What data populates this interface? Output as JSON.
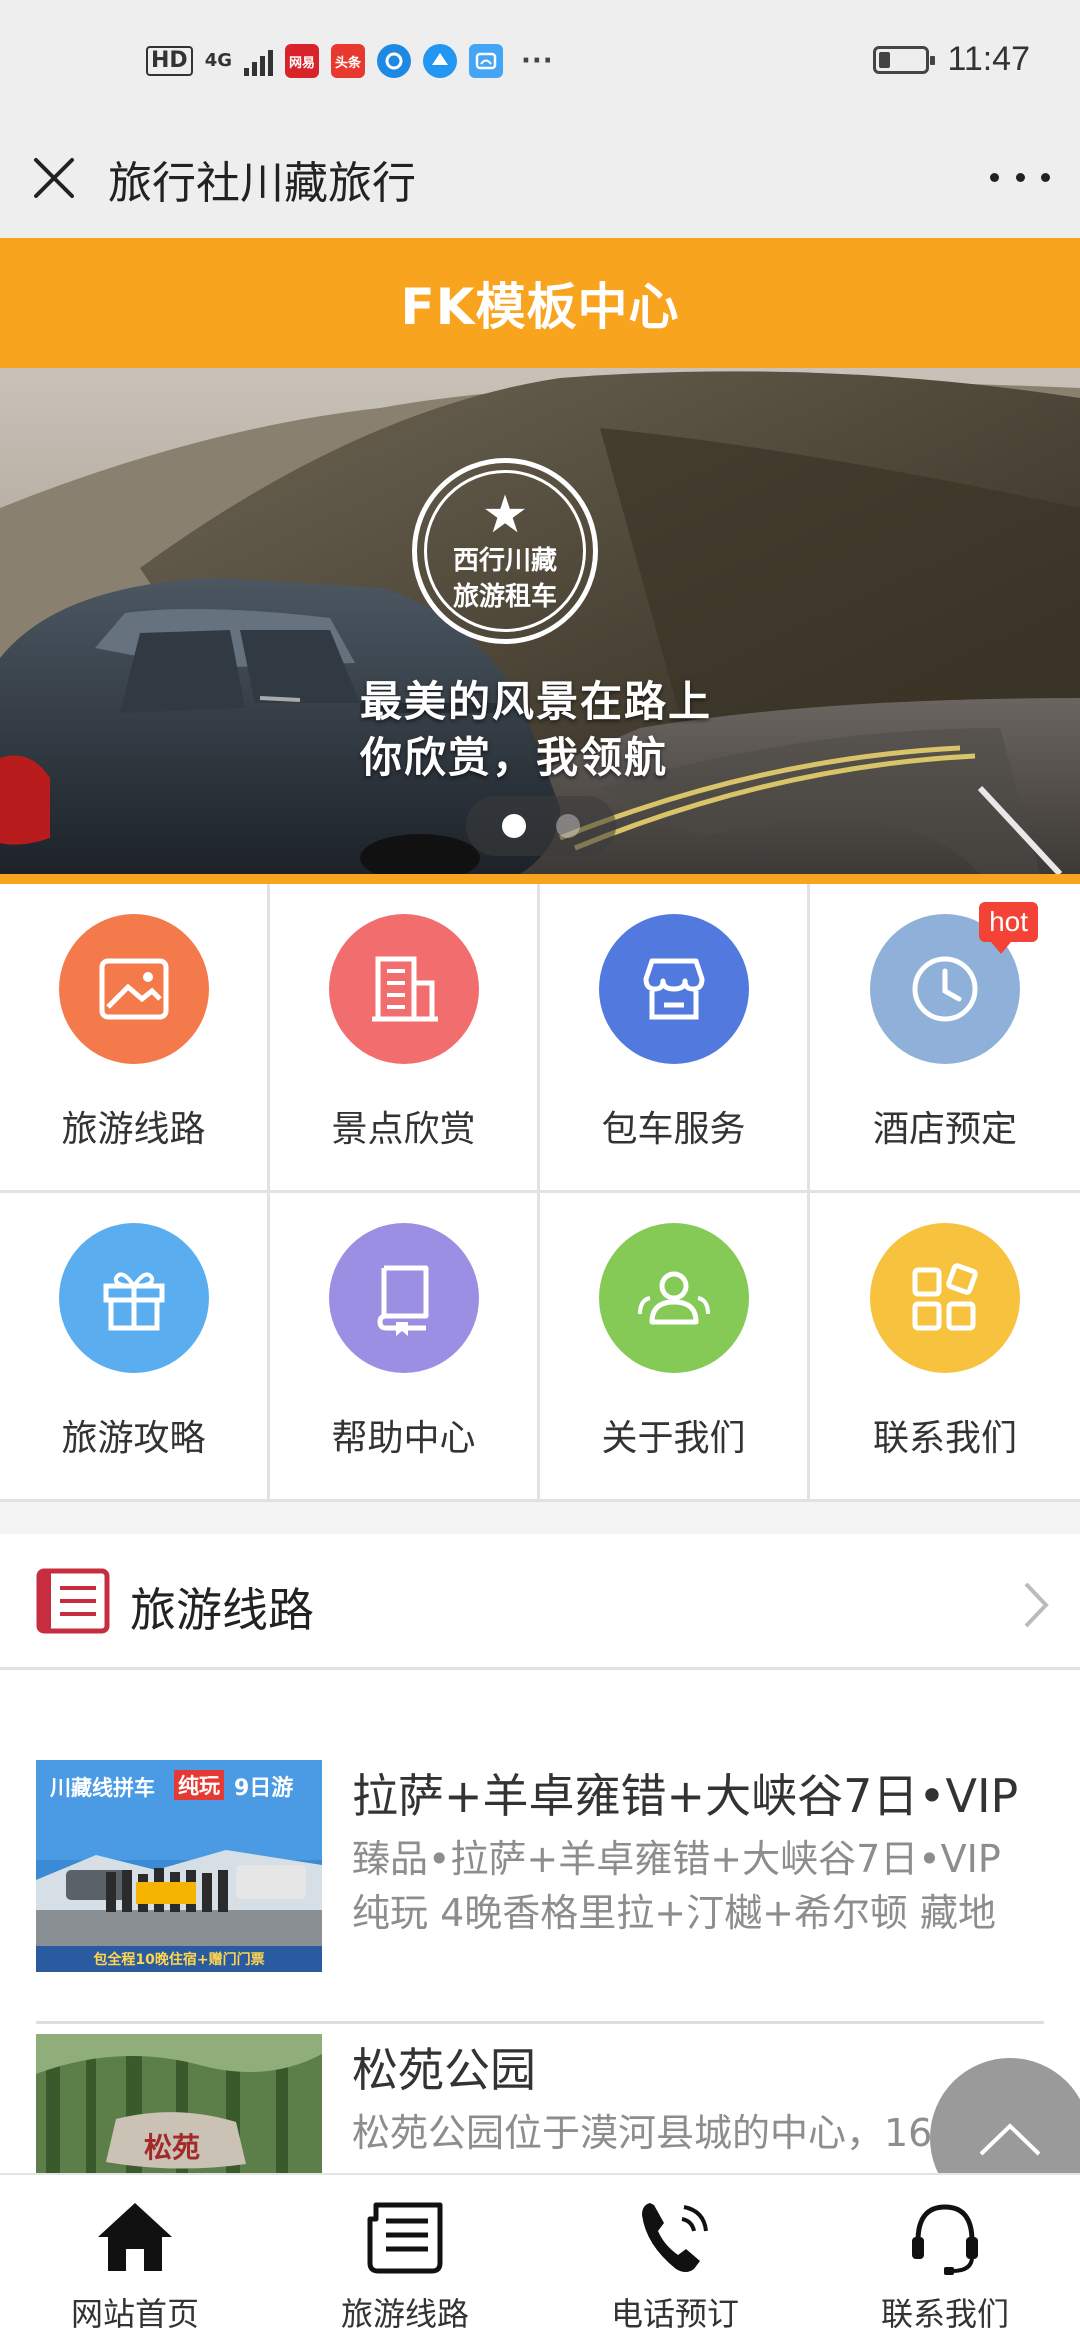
{
  "status_bar": {
    "hd": "HD",
    "network": "4G",
    "apps": [
      {
        "name": "netease-news-app-icon",
        "text": "网易",
        "color": "#d8232a"
      },
      {
        "name": "toutiao-app-icon",
        "text": "头条",
        "color": "#e8382f"
      },
      {
        "name": "security-app-icon",
        "text": "",
        "color": "#1e88e5"
      },
      {
        "name": "browser-app-icon",
        "text": "",
        "color": "#2196f3"
      },
      {
        "name": "cloud-app-icon",
        "text": "",
        "color": "#42a5f5"
      }
    ],
    "more": "···",
    "battery_level": 0.25,
    "time": "11:47"
  },
  "titlebar": {
    "title": "旅行社川藏旅行"
  },
  "site_header": {
    "title": "FK模板中心"
  },
  "banner": {
    "emblem_line1": "西行川藏",
    "emblem_line2": "旅游租车",
    "slogan_line1": "最美的风景在路上",
    "slogan_line2": "你欣赏，我领航",
    "slide_count": 2,
    "active_slide": 1
  },
  "grid": {
    "items": [
      {
        "label": "旅游线路",
        "color": "#f47a4b",
        "icon": "image-icon"
      },
      {
        "label": "景点欣赏",
        "color": "#f26d6d",
        "icon": "building-icon"
      },
      {
        "label": "包车服务",
        "color": "#5279dd",
        "icon": "store-icon"
      },
      {
        "label": "酒店预定",
        "color": "#8fb0d8",
        "icon": "clock-icon",
        "badge": "hot"
      },
      {
        "label": "旅游攻略",
        "color": "#5aaef0",
        "icon": "gift-icon"
      },
      {
        "label": "帮助中心",
        "color": "#9b8fe3",
        "icon": "book-icon"
      },
      {
        "label": "关于我们",
        "color": "#85c956",
        "icon": "users-icon"
      },
      {
        "label": "联系我们",
        "color": "#f7c23d",
        "icon": "apps-icon"
      }
    ]
  },
  "section": {
    "title": "旅游线路"
  },
  "routes": [
    {
      "title": "拉萨+羊卓雍错+大峡谷7日•VIP",
      "desc_line1": "臻品•拉萨+羊卓雍错+大峡谷7日•VIP",
      "desc_line2": "纯玩 4晚香格里拉+汀樾+希尔顿 藏地",
      "thumb_heading": "川藏线拼车",
      "thumb_tag": "纯玩",
      "thumb_days": "9日游",
      "thumb_footer": "包全程10晚住宿+赠门门票"
    },
    {
      "title": "松苑公园",
      "desc_line1": "松苑公园位于漠河县城的中心，16",
      "desc_line2": "",
      "thumb_stone": "松苑"
    }
  ],
  "bottom_nav": {
    "items": [
      {
        "label": "网站首页"
      },
      {
        "label": "旅游线路"
      },
      {
        "label": "电话预订"
      },
      {
        "label": "联系我们"
      }
    ]
  }
}
